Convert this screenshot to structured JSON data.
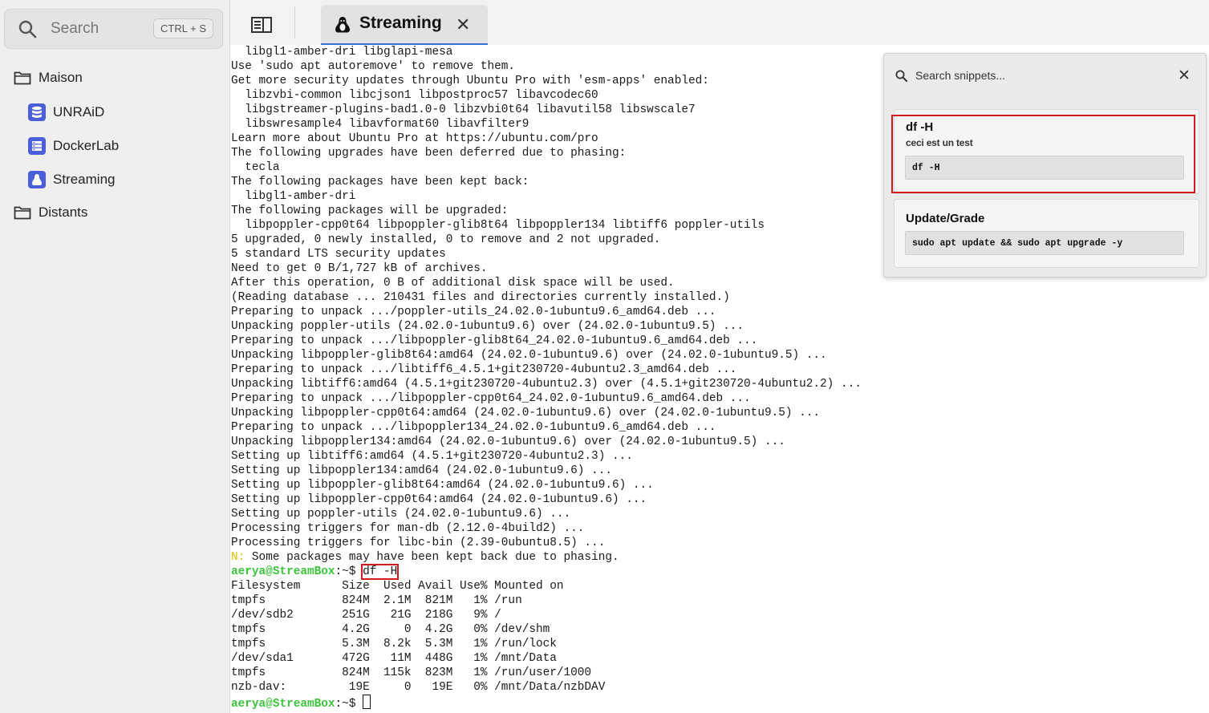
{
  "sidebar": {
    "search_placeholder": "Search",
    "search_shortcut": "CTRL + S",
    "groups": [
      {
        "label": "Maison",
        "icon": "folder-icon"
      },
      {
        "label": "Distants",
        "icon": "folder-icon"
      }
    ],
    "hosts": [
      {
        "label": "UNRAiD",
        "icon": "database-icon"
      },
      {
        "label": "DockerLab",
        "icon": "server-icon"
      },
      {
        "label": "Streaming",
        "icon": "tux-icon"
      }
    ],
    "accent_color": "#4a5fd9"
  },
  "tabs": [
    {
      "label": "Streaming",
      "icon": "tux-icon",
      "active": true
    }
  ],
  "terminal": {
    "prompt_user": "aerya@StreamBox",
    "prompt_suffix": ":~$ ",
    "highlighted_command": "df -H",
    "notice_prefix": "N:",
    "notice_text": " Some packages may have been kept back due to phasing.",
    "lines": [
      "  libgl1-amber-dri libglapi-mesa",
      "Use 'sudo apt autoremove' to remove them.",
      "Get more security updates through Ubuntu Pro with 'esm-apps' enabled:",
      "  libzvbi-common libcjson1 libpostproc57 libavcodec60",
      "  libgstreamer-plugins-bad1.0-0 libzvbi0t64 libavutil58 libswscale7",
      "  libswresample4 libavformat60 libavfilter9",
      "Learn more about Ubuntu Pro at https://ubuntu.com/pro",
      "The following upgrades have been deferred due to phasing:",
      "  tecla",
      "The following packages have been kept back:",
      "  libgl1-amber-dri",
      "The following packages will be upgraded:",
      "  libpoppler-cpp0t64 libpoppler-glib8t64 libpoppler134 libtiff6 poppler-utils",
      "5 upgraded, 0 newly installed, 0 to remove and 2 not upgraded.",
      "5 standard LTS security updates",
      "Need to get 0 B/1,727 kB of archives.",
      "After this operation, 0 B of additional disk space will be used.",
      "(Reading database ... 210431 files and directories currently installed.)",
      "Preparing to unpack .../poppler-utils_24.02.0-1ubuntu9.6_amd64.deb ...",
      "Unpacking poppler-utils (24.02.0-1ubuntu9.6) over (24.02.0-1ubuntu9.5) ...",
      "Preparing to unpack .../libpoppler-glib8t64_24.02.0-1ubuntu9.6_amd64.deb ...",
      "Unpacking libpoppler-glib8t64:amd64 (24.02.0-1ubuntu9.6) over (24.02.0-1ubuntu9.5) ...",
      "Preparing to unpack .../libtiff6_4.5.1+git230720-4ubuntu2.3_amd64.deb ...",
      "Unpacking libtiff6:amd64 (4.5.1+git230720-4ubuntu2.3) over (4.5.1+git230720-4ubuntu2.2) ...",
      "Preparing to unpack .../libpoppler-cpp0t64_24.02.0-1ubuntu9.6_amd64.deb ...",
      "Unpacking libpoppler-cpp0t64:amd64 (24.02.0-1ubuntu9.6) over (24.02.0-1ubuntu9.5) ...",
      "Preparing to unpack .../libpoppler134_24.02.0-1ubuntu9.6_amd64.deb ...",
      "Unpacking libpoppler134:amd64 (24.02.0-1ubuntu9.6) over (24.02.0-1ubuntu9.5) ...",
      "Setting up libtiff6:amd64 (4.5.1+git230720-4ubuntu2.3) ...",
      "Setting up libpoppler134:amd64 (24.02.0-1ubuntu9.6) ...",
      "Setting up libpoppler-glib8t64:amd64 (24.02.0-1ubuntu9.6) ...",
      "Setting up libpoppler-cpp0t64:amd64 (24.02.0-1ubuntu9.6) ...",
      "Setting up poppler-utils (24.02.0-1ubuntu9.6) ...",
      "Processing triggers for man-db (2.12.0-4build2) ...",
      "Processing triggers for libc-bin (2.39-0ubuntu8.5) ..."
    ],
    "df_output": [
      "Filesystem      Size  Used Avail Use% Mounted on",
      "tmpfs           824M  2.1M  821M   1% /run",
      "/dev/sdb2       251G   21G  218G   9% /",
      "tmpfs           4.2G     0  4.2G   0% /dev/shm",
      "tmpfs           5.3M  8.2k  5.3M   1% /run/lock",
      "/dev/sda1       472G   11M  448G   1% /mnt/Data",
      "tmpfs           824M  115k  823M   1% /run/user/1000",
      "nzb-dav:         19E     0   19E   0% /mnt/Data/nzbDAV"
    ]
  },
  "snippets": {
    "search_placeholder": "Search snippets...",
    "items": [
      {
        "title": "df -H",
        "description": "ceci est un test",
        "command": "df -H"
      },
      {
        "title": "Update/Grade",
        "description": "",
        "command": "sudo apt update && sudo apt upgrade -y"
      }
    ]
  },
  "colors": {
    "highlight_border": "#d21a1a",
    "prompt_green": "#3cc43c",
    "notice_yellow": "#e0c000",
    "tab_underline": "#3b6fd6"
  }
}
